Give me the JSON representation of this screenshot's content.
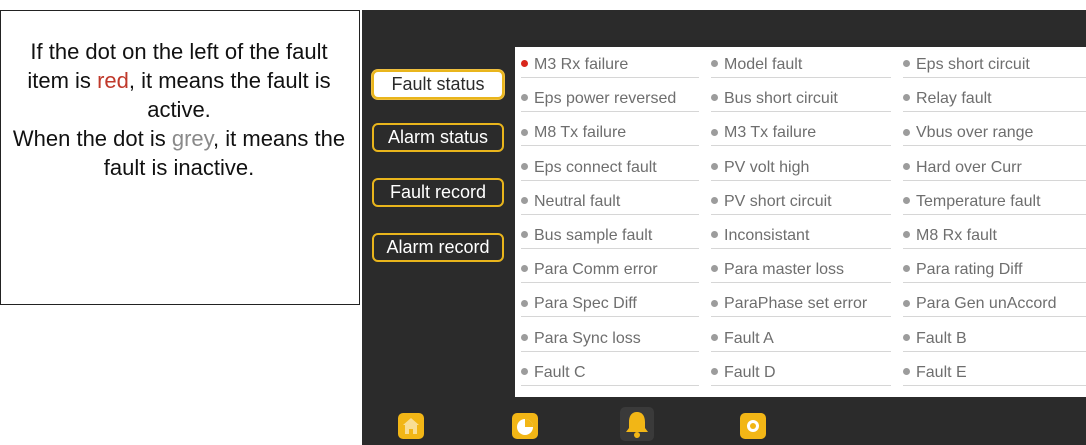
{
  "note": {
    "line1": "If the dot on the left of the fault item is ",
    "red_word": "red",
    "line1_end": ", it means the fault is active.",
    "line2": "When the dot is ",
    "grey_word": "grey",
    "line2_end": ", it means the fault is inactive."
  },
  "sidebar": {
    "items": [
      {
        "label": "Fault status",
        "active": true
      },
      {
        "label": "Alarm status",
        "active": false
      },
      {
        "label": "Fault record",
        "active": false
      },
      {
        "label": "Alarm record",
        "active": false
      }
    ]
  },
  "faults": {
    "columns": [
      [
        "M3 Rx failure",
        "Eps power reversed",
        "M8 Tx failure",
        "Eps connect fault",
        "Neutral fault",
        "Bus sample fault",
        "Para Comm error",
        "Para Spec Diff",
        "Para Sync loss",
        "Fault C"
      ],
      [
        "Model fault",
        "Bus short circuit",
        "M3 Tx failure",
        "PV volt high",
        "PV short circuit",
        "Inconsistant",
        "Para master loss",
        "ParaPhase set error",
        "Fault A",
        "Fault D"
      ],
      [
        "Eps short circuit",
        "Relay fault",
        "Vbus over range",
        "Hard over Curr",
        "Temperature fault",
        "M8 Rx fault",
        "Para rating Diff",
        "Para Gen unAccord",
        "Fault B",
        "Fault E"
      ]
    ],
    "active_items": [
      "M3 Rx failure"
    ],
    "active_color": "#d9261c",
    "inactive_color": "#9c9c9c"
  },
  "navbar": {
    "items": [
      {
        "icon": "home-icon"
      },
      {
        "icon": "pie-chart-icon"
      },
      {
        "icon": "bell-icon",
        "selected": true
      },
      {
        "icon": "gear-icon"
      }
    ],
    "accent": "#f2b616"
  }
}
